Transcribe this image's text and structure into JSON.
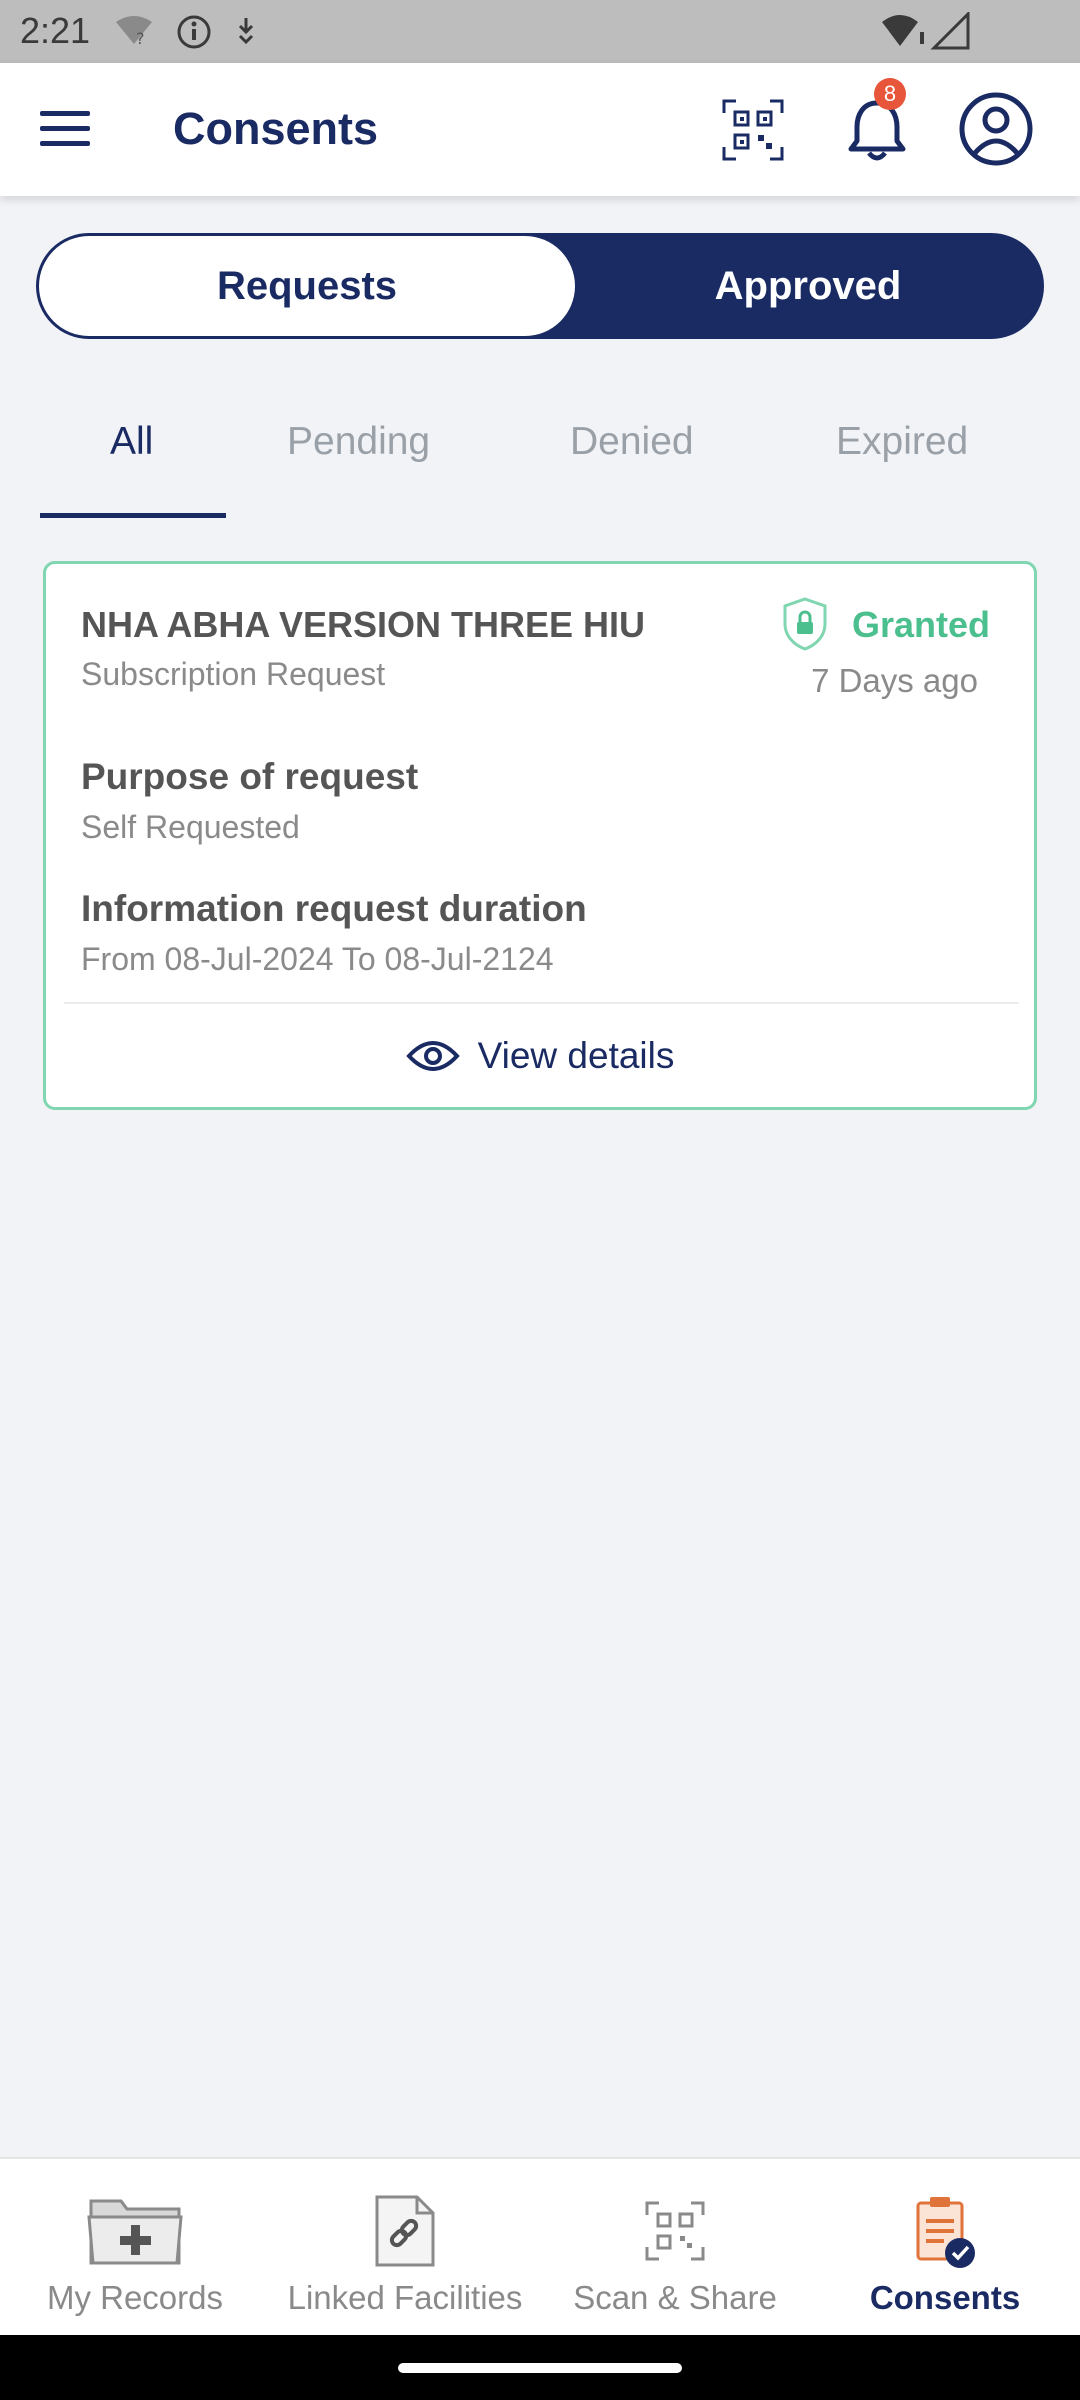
{
  "status_bar": {
    "time": "2:21"
  },
  "header": {
    "title": "Consents",
    "notification_count": "8",
    "icons": {
      "menu": "menu-icon",
      "qr": "qr-code-icon",
      "bell": "bell-icon",
      "profile": "profile-icon"
    }
  },
  "segmented_control": {
    "requests_label": "Requests",
    "approved_label": "Approved",
    "selected": "Requests"
  },
  "filter_tabs": {
    "items": [
      {
        "label": "All"
      },
      {
        "label": "Pending"
      },
      {
        "label": "Denied"
      },
      {
        "label": "Expired"
      }
    ],
    "selected": "All"
  },
  "consent_card": {
    "title": "NHA ABHA VERSION THREE HIU",
    "subtitle": "Subscription Request",
    "status": "Granted",
    "status_color": "#4cbf8e",
    "time_ago": "7 Days ago",
    "purpose_label": "Purpose of request",
    "purpose_value": "Self Requested",
    "duration_label": "Information request duration",
    "duration_value": "From 08-Jul-2024 To 08-Jul-2124",
    "view_details_label": "View details"
  },
  "bottom_nav": {
    "items": [
      {
        "label": "My Records",
        "icon": "folder-plus-icon"
      },
      {
        "label": "Linked Facilities",
        "icon": "linked-document-icon"
      },
      {
        "label": "Scan & Share",
        "icon": "qr-scan-icon"
      },
      {
        "label": "Consents",
        "icon": "consent-document-icon"
      }
    ],
    "active": "Consents"
  },
  "colors": {
    "primary": "#1a2b63",
    "accent_orange": "#e0733a",
    "granted_green": "#4cbf8e",
    "badge_red": "#e7553a"
  }
}
